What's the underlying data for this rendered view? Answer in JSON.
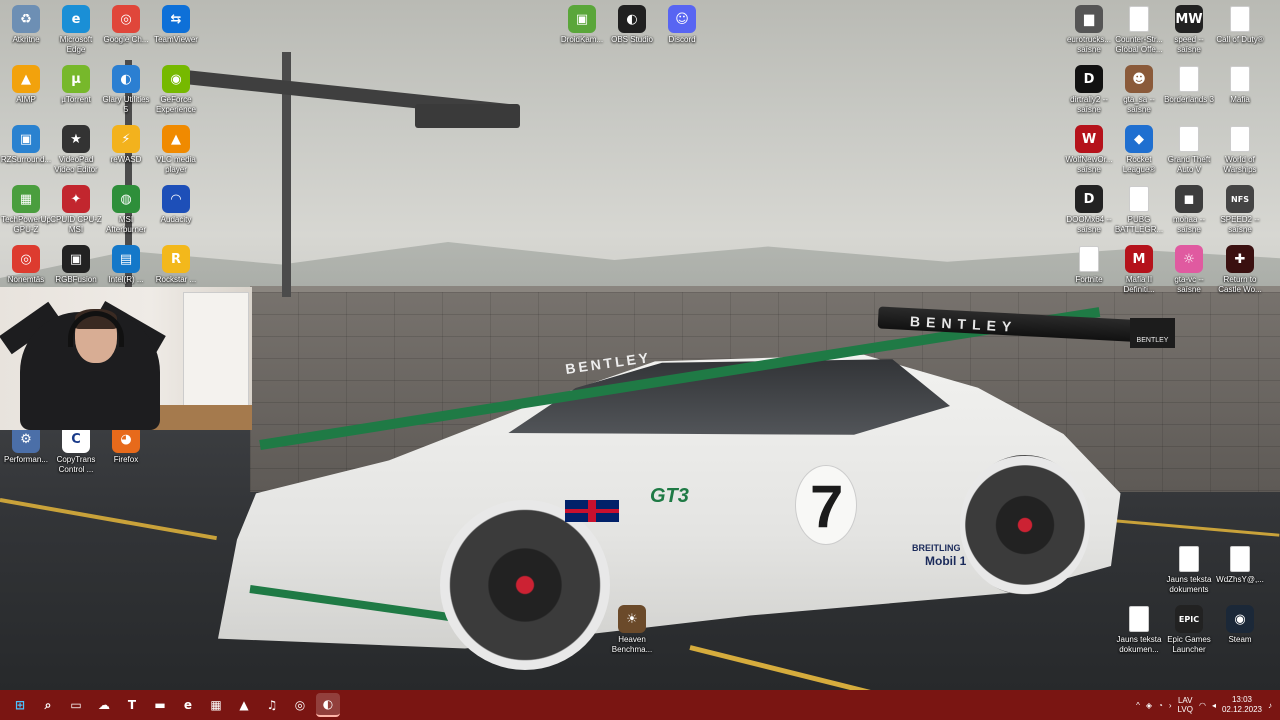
{
  "desktop": {
    "icons": [
      {
        "label": "Atkritne",
        "icon": "recycle-bin-icon",
        "color": "#6d8fb4",
        "glyph": "♻"
      },
      {
        "label": "Microsoft Edge",
        "icon": "edge-icon",
        "color": "#1a8fd6",
        "glyph": "e"
      },
      {
        "label": "Google Ch...",
        "icon": "chrome-icon",
        "color": "#e0463a",
        "glyph": "◎"
      },
      {
        "label": "TeamViewer",
        "icon": "teamviewer-icon",
        "color": "#0e70d8",
        "glyph": "⇆"
      },
      {
        "label": "AIMP",
        "icon": "aimp-icon",
        "color": "#f2a20c",
        "glyph": "▲"
      },
      {
        "label": "µTorrent",
        "icon": "utorrent-icon",
        "color": "#77b82b",
        "glyph": "µ"
      },
      {
        "label": "Glary Utilities 5",
        "icon": "glary-utilities-icon",
        "color": "#2b7fd2",
        "glyph": "◐"
      },
      {
        "label": "GeForce Experience",
        "icon": "geforce-icon",
        "color": "#76b900",
        "glyph": "◉"
      },
      {
        "label": "RZSurround...",
        "icon": "rzsurround-icon",
        "color": "#2a82d0",
        "glyph": "▣"
      },
      {
        "label": "VideoPad Video Editor",
        "icon": "videopad-icon",
        "color": "#333333",
        "glyph": "★"
      },
      {
        "label": "reWASD",
        "icon": "rewasd-icon",
        "color": "#f3b21d",
        "glyph": "⚡"
      },
      {
        "label": "VLC media player",
        "icon": "vlc-icon",
        "color": "#f08a00",
        "glyph": "▲"
      },
      {
        "label": "TechPowerUp GPU-Z",
        "icon": "gpuz-icon",
        "color": "#4a9e3e",
        "glyph": "▦"
      },
      {
        "label": "CPUID CPU-Z MSI",
        "icon": "cpuz-icon",
        "color": "#c2262e",
        "glyph": "✦"
      },
      {
        "label": "MSI Afterburner",
        "icon": "msi-afterburner-icon",
        "color": "#2e8f3a",
        "glyph": "◍"
      },
      {
        "label": "Audacity",
        "icon": "audacity-icon",
        "color": "#1d4fb8",
        "glyph": "◠"
      },
      {
        "label": "Nonemtās",
        "icon": "nonemtas-icon",
        "color": "#dd3b2f",
        "glyph": "◎"
      },
      {
        "label": "RGBFusion",
        "icon": "rgbfusion-icon",
        "color": "#222222",
        "glyph": "▣"
      },
      {
        "label": "Intel(R) ...",
        "icon": "intel-icon",
        "color": "#1478c9",
        "glyph": "▤"
      },
      {
        "label": "Rockstar ...",
        "icon": "rockstar-icon",
        "color": "#f3b81b",
        "glyph": "R"
      },
      {
        "label": "Performan...",
        "icon": "performance-icon",
        "color": "#4b6fa8",
        "glyph": "⚙"
      },
      {
        "label": "CopyTrans Control ...",
        "icon": "copytrans-icon",
        "color": "#ffffff",
        "glyph": "C"
      },
      {
        "label": "Firefox",
        "icon": "firefox-icon",
        "color": "#e76a1b",
        "glyph": "◕"
      },
      {
        "label": "DroidKam...",
        "icon": "droidcam-icon",
        "color": "#5aa63a",
        "glyph": "▣"
      },
      {
        "label": "OBS Studio",
        "icon": "obs-icon",
        "color": "#202020",
        "glyph": "◐"
      },
      {
        "label": "Discord",
        "icon": "discord-icon",
        "color": "#5865f2",
        "glyph": "☺"
      },
      {
        "label": "eurotrucks... saīsne",
        "icon": "eurotrucks-icon",
        "color": "#555555",
        "glyph": "▆"
      },
      {
        "label": "Counter-Str... Global Offe...",
        "icon": "file-icon",
        "color": "#ffffff",
        "glyph": ""
      },
      {
        "label": "speed -- saīsne",
        "icon": "nfs-speed-icon",
        "color": "#222222",
        "glyph": "MW"
      },
      {
        "label": "Call of Duty®",
        "icon": "file-icon",
        "color": "#ffffff",
        "glyph": ""
      },
      {
        "label": "dirtrally2 -- saīsne",
        "icon": "dirt-rally-icon",
        "color": "#111111",
        "glyph": "D"
      },
      {
        "label": "gta_sa -- saīsne",
        "icon": "gta-sa-icon",
        "color": "#8a5a3a",
        "glyph": "☻"
      },
      {
        "label": "Borderlands 3",
        "icon": "file-icon",
        "color": "#ffffff",
        "glyph": ""
      },
      {
        "label": "Mafia",
        "icon": "file-icon",
        "color": "#ffffff",
        "glyph": ""
      },
      {
        "label": "WolfNewOr... saīsne",
        "icon": "wolfenstein-icon",
        "color": "#b5121b",
        "glyph": "W"
      },
      {
        "label": "Rocket League®",
        "icon": "rocket-league-icon",
        "color": "#1f6fd0",
        "glyph": "◆"
      },
      {
        "label": "Grand Theft Auto V",
        "icon": "file-icon",
        "color": "#ffffff",
        "glyph": ""
      },
      {
        "label": "World of Warships",
        "icon": "file-icon",
        "color": "#ffffff",
        "glyph": ""
      },
      {
        "label": "DOOMx64 -- saīsne",
        "icon": "doom-icon",
        "color": "#222222",
        "glyph": "D"
      },
      {
        "label": "PUBG BATTLEGR...",
        "icon": "file-icon",
        "color": "#ffffff",
        "glyph": ""
      },
      {
        "label": "mohaa -- saīsne",
        "icon": "mohaa-icon",
        "color": "#3d3d3d",
        "glyph": "◼"
      },
      {
        "label": "SPEED2 -- saīsne",
        "icon": "speed2-icon",
        "color": "#444444",
        "glyph": "NFS"
      },
      {
        "label": "Fortnite",
        "icon": "file-icon",
        "color": "#ffffff",
        "glyph": ""
      },
      {
        "label": "Mafia II Definiti...",
        "icon": "mafia2-icon",
        "color": "#b5121b",
        "glyph": "M"
      },
      {
        "label": "gta-vc -- saīsne",
        "icon": "gta-vc-icon",
        "color": "#e05aa0",
        "glyph": "☼"
      },
      {
        "label": "Return to Castle Wo...",
        "icon": "rtcw-icon",
        "color": "#3a1010",
        "glyph": "✚"
      },
      {
        "label": "Jauns teksta dokuments",
        "icon": "text-document-icon",
        "color": "#ffffff",
        "glyph": ""
      },
      {
        "label": "WdZhsY@,...",
        "icon": "text-document-icon",
        "color": "#ffffff",
        "glyph": ""
      },
      {
        "label": "Heaven Benchma...",
        "icon": "heaven-benchmark-icon",
        "color": "#6b4a2a",
        "glyph": "☀"
      },
      {
        "label": "Jauns teksta dokumen...",
        "icon": "text-document-icon",
        "color": "#ffffff",
        "glyph": ""
      },
      {
        "label": "Epic Games Launcher",
        "icon": "epic-games-icon",
        "color": "#222222",
        "glyph": "EPIC"
      },
      {
        "label": "Steam",
        "icon": "steam-icon",
        "color": "#1b2838",
        "glyph": "◉"
      }
    ]
  },
  "wallpaper": {
    "car_number": "7",
    "windshield_text": "BENTLEY",
    "spoiler_text": "BENTLEY",
    "badge_text": "BENTLEY",
    "model_text": "GT3",
    "sponsor_1": "BREITLING",
    "sponsor_2": "Mobil 1"
  },
  "taskbar": {
    "buttons": [
      {
        "name": "start-button",
        "icon": "windows-icon",
        "glyph": "⊞"
      },
      {
        "name": "search-button",
        "icon": "search-icon",
        "glyph": "⌕"
      },
      {
        "name": "task-view-button",
        "icon": "task-view-icon",
        "glyph": "▭"
      },
      {
        "name": "weather-button",
        "icon": "weather-icon",
        "glyph": "☁"
      },
      {
        "name": "teams-button",
        "icon": "teams-icon",
        "glyph": "T"
      },
      {
        "name": "file-explorer-button",
        "icon": "folder-icon",
        "glyph": "▬"
      },
      {
        "name": "edge-button",
        "icon": "edge-icon",
        "glyph": "e"
      },
      {
        "name": "store-button",
        "icon": "store-icon",
        "glyph": "▦"
      },
      {
        "name": "aimp-button",
        "icon": "aimp-icon",
        "glyph": "▲"
      },
      {
        "name": "itunes-button",
        "icon": "music-icon",
        "glyph": "♫"
      },
      {
        "name": "chrome-button",
        "icon": "chrome-icon",
        "glyph": "◎"
      },
      {
        "name": "obs-button",
        "icon": "obs-icon",
        "glyph": "◐"
      }
    ],
    "tray": {
      "language_top": "LAV",
      "language_bottom": "LVQ",
      "time": "13:03",
      "date": "02.12.2023",
      "overflow_glyph": "^"
    }
  }
}
